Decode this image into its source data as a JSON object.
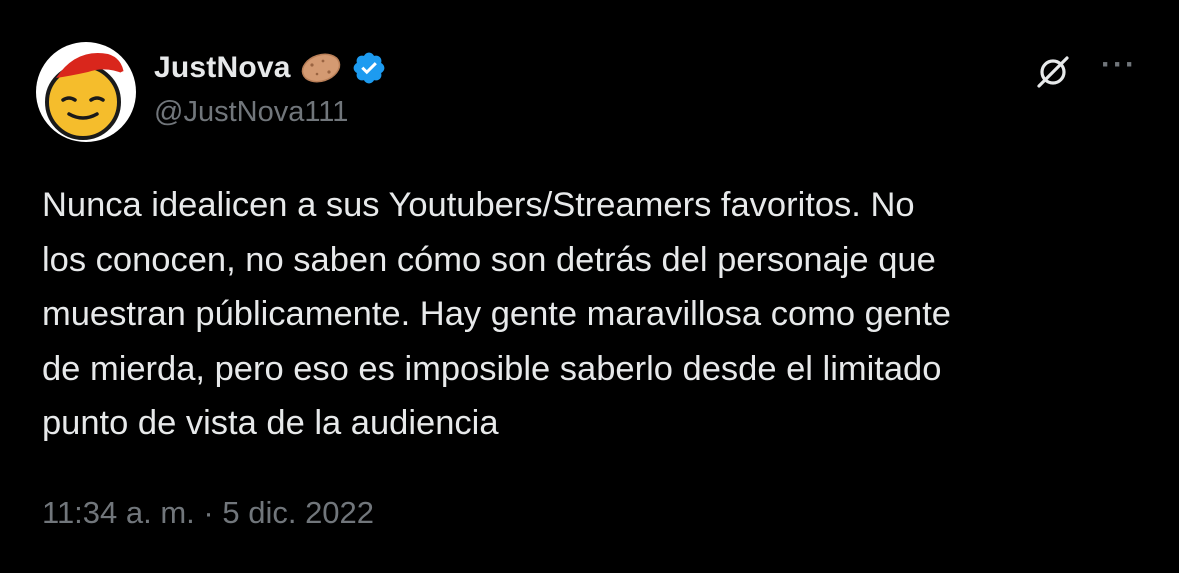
{
  "tweet": {
    "author": {
      "display_name": "JustNova",
      "handle": "@JustNova111",
      "verified": true,
      "avatar": "santa-hat-smiley-avatar",
      "name_emoji": "potato-emoji"
    },
    "text": "Nunca idealicen a sus Youtubers/Streamers favoritos. No\nlos conocen, no saben cómo son detrás del personaje que\nmuestran públicamente. Hay gente maravillosa como gente\nde mierda, pero eso es imposible saberlo desde el limitado\npunto de vista de la audiencia",
    "time": "11:34 a. m.",
    "separator": " · ",
    "date": "5 dic. 2022"
  },
  "actions": {
    "grok_icon": "grok-icon",
    "more_label": "···"
  },
  "colors": {
    "background": "#000000",
    "primary_text": "#e7e9ea",
    "secondary_text": "#71767b",
    "verified_blue": "#1d9bf0"
  }
}
